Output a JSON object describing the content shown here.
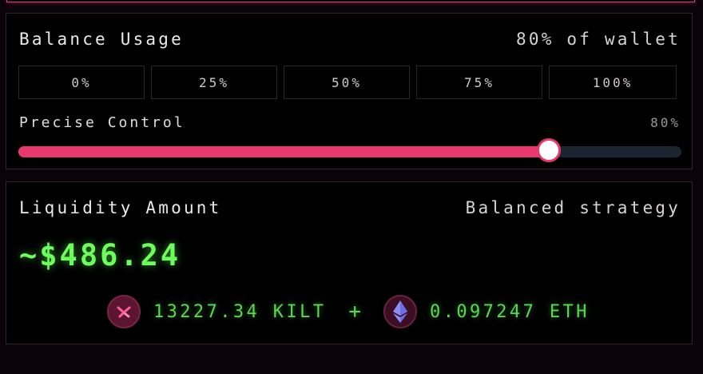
{
  "balance": {
    "title": "Balance Usage",
    "usage_text": "80% of wallet",
    "presets": [
      "0%",
      "25%",
      "50%",
      "75%",
      "100%"
    ],
    "precise_label": "Precise Control",
    "precise_value": "80%",
    "slider_fraction": 0.8
  },
  "liquidity": {
    "title": "Liquidity Amount",
    "strategy": "Balanced strategy",
    "amount": "~$486.24",
    "plus": "+",
    "tokens": [
      {
        "amount": "13227.34 KILT",
        "icon": "kilt-icon"
      },
      {
        "amount": "0.097247 ETH",
        "icon": "eth-icon"
      }
    ]
  },
  "colors": {
    "accent": "#e8386d",
    "green": "#6cff5c",
    "track": "#1c2430"
  }
}
